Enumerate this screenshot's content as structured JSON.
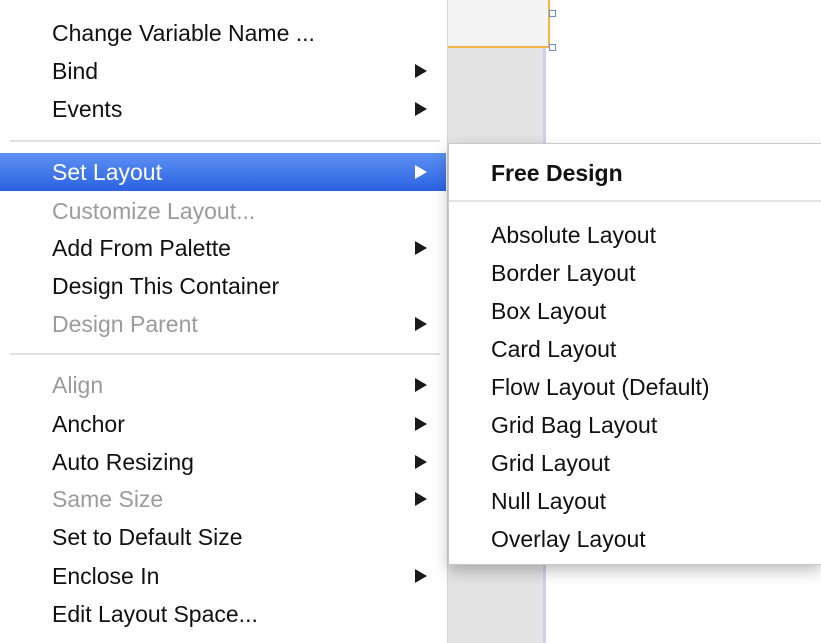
{
  "context_menu": {
    "items": [
      {
        "label": "Change Variable Name ...",
        "enabled": true,
        "has_submenu": false
      },
      {
        "label": "Bind",
        "enabled": true,
        "has_submenu": true
      },
      {
        "label": "Events",
        "enabled": true,
        "has_submenu": true
      },
      {
        "label": "Set Layout",
        "enabled": true,
        "has_submenu": true,
        "highlighted": true
      },
      {
        "label": "Customize Layout...",
        "enabled": false,
        "has_submenu": false
      },
      {
        "label": "Add From Palette",
        "enabled": true,
        "has_submenu": true
      },
      {
        "label": "Design This Container",
        "enabled": true,
        "has_submenu": false
      },
      {
        "label": "Design Parent",
        "enabled": false,
        "has_submenu": true
      },
      {
        "label": "Align",
        "enabled": false,
        "has_submenu": true
      },
      {
        "label": "Anchor",
        "enabled": true,
        "has_submenu": true
      },
      {
        "label": "Auto Resizing",
        "enabled": true,
        "has_submenu": true
      },
      {
        "label": "Same Size",
        "enabled": false,
        "has_submenu": true
      },
      {
        "label": "Set to Default Size",
        "enabled": true,
        "has_submenu": false
      },
      {
        "label": "Enclose In",
        "enabled": true,
        "has_submenu": true
      },
      {
        "label": "Edit Layout Space...",
        "enabled": true,
        "has_submenu": false
      }
    ]
  },
  "layout_submenu": {
    "header": "Free Design",
    "items": [
      "Absolute Layout",
      "Border Layout",
      "Box Layout",
      "Card Layout",
      "Flow Layout (Default)",
      "Grid Bag Layout",
      "Grid Layout",
      "Null Layout",
      "Overlay Layout"
    ]
  },
  "colors": {
    "highlight": "#3a72ea",
    "disabled_text": "#9b9b9b",
    "selection_border": "#f0b545"
  }
}
